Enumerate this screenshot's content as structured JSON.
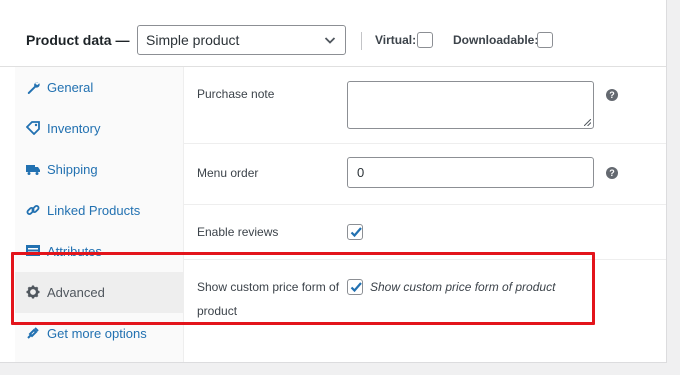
{
  "header": {
    "title": "Product data —",
    "product_type": "Simple product",
    "virtual_label": "Virtual:",
    "downloadable_label": "Downloadable:"
  },
  "sidebar": {
    "items": [
      {
        "label": "General",
        "icon": "wrench-icon"
      },
      {
        "label": "Inventory",
        "icon": "tag-icon"
      },
      {
        "label": "Shipping",
        "icon": "truck-icon"
      },
      {
        "label": "Linked Products",
        "icon": "link-icon"
      },
      {
        "label": "Attributes",
        "icon": "list-icon"
      },
      {
        "label": "Advanced",
        "icon": "gear-icon"
      },
      {
        "label": "Get more options",
        "icon": "plugin-icon"
      }
    ]
  },
  "fields": {
    "purchase_note": {
      "label": "Purchase note",
      "value": ""
    },
    "menu_order": {
      "label": "Menu order",
      "value": "0"
    },
    "enable_reviews": {
      "label": "Enable reviews",
      "checked": true
    },
    "custom_price": {
      "label_line1": "Show custom price form of",
      "label_line2": "product",
      "description": "Show custom price form of product",
      "checked": true
    }
  },
  "help_symbol": "?",
  "colors": {
    "link": "#2271b1",
    "highlight": "#e3141b",
    "active_tab_bg": "#eeeeee"
  }
}
